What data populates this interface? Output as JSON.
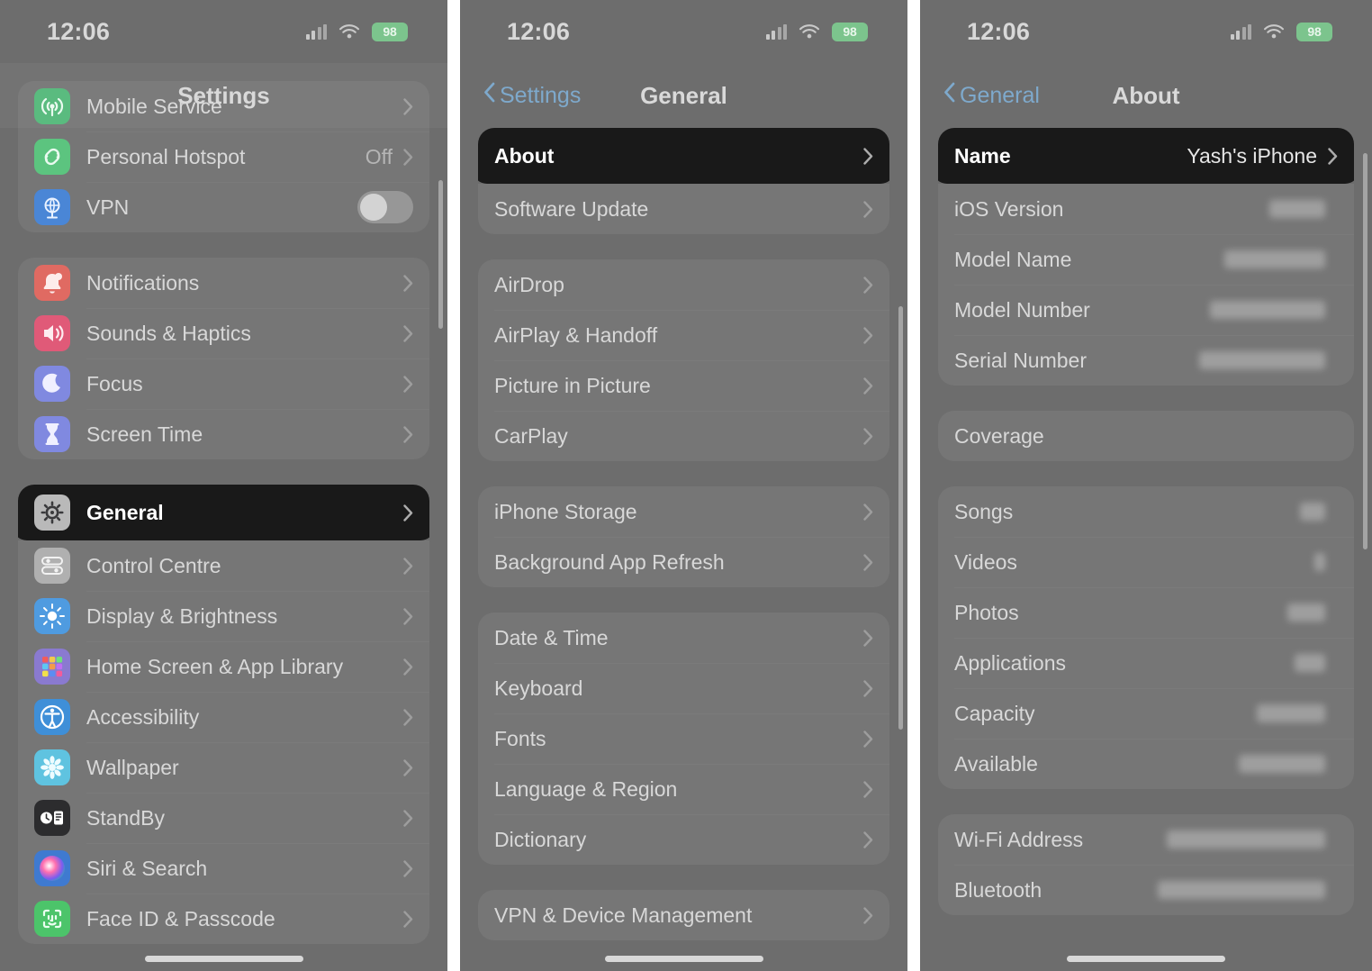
{
  "meta": {
    "accent_blue": "#7ea9cc",
    "highlight_bg": "#191919",
    "dim_bg": "#6d6d6d",
    "battery_green": "#7cc48d"
  },
  "status_bar": {
    "time": "12:06",
    "battery_percent": "98",
    "cellular_icon": "cellular-signal-icon",
    "wifi_icon": "wifi-icon",
    "battery_icon": "battery-icon"
  },
  "panels": [
    {
      "id": "settings",
      "nav": {
        "title": "Settings",
        "back_label": "",
        "has_back": false
      },
      "groups": [
        {
          "partial_top": true,
          "rows": [
            {
              "label": "Mobile Service",
              "icon": "mobile-service-icon",
              "icon_color": "#53b87a",
              "value": "",
              "accessory": "chevron"
            },
            {
              "label": "Personal Hotspot",
              "icon": "personal-hotspot-icon",
              "icon_color": "#5cc47f",
              "value": "Off",
              "accessory": "chevron"
            },
            {
              "label": "VPN",
              "icon": "vpn-icon",
              "icon_color": "#4a86d6",
              "value": "",
              "accessory": "toggle"
            }
          ]
        },
        {
          "rows": [
            {
              "label": "Notifications",
              "icon": "notifications-bell-icon",
              "icon_color": "#e06a62",
              "value": "",
              "accessory": "chevron"
            },
            {
              "label": "Sounds & Haptics",
              "icon": "sounds-haptics-icon",
              "icon_color": "#e05a78",
              "value": "",
              "accessory": "chevron"
            },
            {
              "label": "Focus",
              "icon": "focus-moon-icon",
              "icon_color": "#8089e0",
              "value": "",
              "accessory": "chevron"
            },
            {
              "label": "Screen Time",
              "icon": "screen-time-hourglass-icon",
              "icon_color": "#8089e0",
              "value": "",
              "accessory": "chevron"
            }
          ]
        },
        {
          "rows": [
            {
              "label": "General",
              "icon": "general-gear-icon",
              "icon_color": "#b9b9b9",
              "value": "",
              "accessory": "chevron",
              "highlight": true
            },
            {
              "label": "Control Centre",
              "icon": "control-centre-icon",
              "icon_color": "#b0b0b0",
              "value": "",
              "accessory": "chevron"
            },
            {
              "label": "Display & Brightness",
              "icon": "display-brightness-icon",
              "icon_color": "#4f9be0",
              "value": "",
              "accessory": "chevron"
            },
            {
              "label": "Home Screen & App Library",
              "icon": "home-screen-app-library-icon",
              "icon_color": "#8a7ad0",
              "value": "",
              "accessory": "chevron"
            },
            {
              "label": "Accessibility",
              "icon": "accessibility-icon",
              "icon_color": "#3f8fd8",
              "value": "",
              "accessory": "chevron"
            },
            {
              "label": "Wallpaper",
              "icon": "wallpaper-icon",
              "icon_color": "#5fc3e0",
              "value": "",
              "accessory": "chevron"
            },
            {
              "label": "StandBy",
              "icon": "standby-icon",
              "icon_color": "#2c2c2e",
              "value": "",
              "accessory": "chevron"
            },
            {
              "label": "Siri & Search",
              "icon": "siri-search-icon",
              "icon_color": "#3f7ad0",
              "value": "",
              "accessory": "chevron"
            },
            {
              "label": "Face ID & Passcode",
              "icon": "face-id-passcode-icon",
              "icon_color": "#4cc46a",
              "value": "",
              "accessory": "chevron"
            }
          ]
        }
      ]
    },
    {
      "id": "general",
      "nav": {
        "title": "General",
        "back_label": "Settings",
        "has_back": true
      },
      "groups": [
        {
          "rows": [
            {
              "label": "About",
              "value": "",
              "accessory": "chevron",
              "highlight": true
            },
            {
              "label": "Software Update",
              "value": "",
              "accessory": "chevron"
            }
          ]
        },
        {
          "rows": [
            {
              "label": "AirDrop",
              "value": "",
              "accessory": "chevron"
            },
            {
              "label": "AirPlay & Handoff",
              "value": "",
              "accessory": "chevron"
            },
            {
              "label": "Picture in Picture",
              "value": "",
              "accessory": "chevron"
            },
            {
              "label": "CarPlay",
              "value": "",
              "accessory": "chevron"
            }
          ]
        },
        {
          "rows": [
            {
              "label": "iPhone Storage",
              "value": "",
              "accessory": "chevron"
            },
            {
              "label": "Background App Refresh",
              "value": "",
              "accessory": "chevron"
            }
          ]
        },
        {
          "rows": [
            {
              "label": "Date & Time",
              "value": "",
              "accessory": "chevron"
            },
            {
              "label": "Keyboard",
              "value": "",
              "accessory": "chevron"
            },
            {
              "label": "Fonts",
              "value": "",
              "accessory": "chevron"
            },
            {
              "label": "Language & Region",
              "value": "",
              "accessory": "chevron"
            },
            {
              "label": "Dictionary",
              "value": "",
              "accessory": "chevron"
            }
          ]
        },
        {
          "rows": [
            {
              "label": "VPN & Device Management",
              "value": "",
              "accessory": "chevron"
            }
          ]
        }
      ]
    },
    {
      "id": "about",
      "nav": {
        "title": "About",
        "back_label": "General",
        "has_back": true
      },
      "groups": [
        {
          "rows": [
            {
              "label": "Name",
              "value": "Yash's iPhone",
              "accessory": "chevron",
              "highlight": true
            },
            {
              "label": "iOS Version",
              "value": "",
              "redacted": 62,
              "accessory": "none"
            },
            {
              "label": "Model Name",
              "value": "",
              "redacted": 112,
              "accessory": "none"
            },
            {
              "label": "Model Number",
              "value": "",
              "redacted": 128,
              "accessory": "none"
            },
            {
              "label": "Serial Number",
              "value": "",
              "redacted": 140,
              "accessory": "none"
            }
          ]
        },
        {
          "rows": [
            {
              "label": "Coverage",
              "value": "",
              "accessory": "none"
            }
          ]
        },
        {
          "rows": [
            {
              "label": "Songs",
              "value": "",
              "redacted": 28,
              "accessory": "none"
            },
            {
              "label": "Videos",
              "value": "",
              "redacted": 12,
              "accessory": "none"
            },
            {
              "label": "Photos",
              "value": "",
              "redacted": 42,
              "accessory": "none"
            },
            {
              "label": "Applications",
              "value": "",
              "redacted": 34,
              "accessory": "none"
            },
            {
              "label": "Capacity",
              "value": "",
              "redacted": 76,
              "accessory": "none"
            },
            {
              "label": "Available",
              "value": "",
              "redacted": 96,
              "accessory": "none"
            }
          ]
        },
        {
          "rows": [
            {
              "label": "Wi-Fi Address",
              "value": "",
              "redacted": 176,
              "accessory": "none"
            },
            {
              "label": "Bluetooth",
              "value": "",
              "redacted": 186,
              "accessory": "none"
            }
          ]
        }
      ]
    }
  ]
}
